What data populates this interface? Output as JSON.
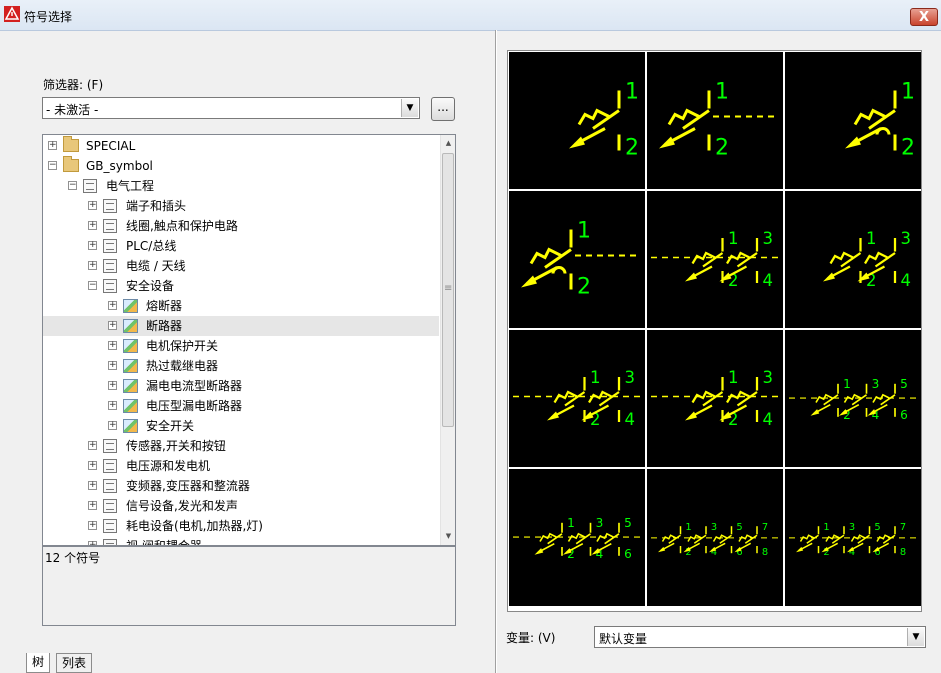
{
  "window": {
    "title": "符号选择",
    "close_label": "X"
  },
  "filter": {
    "label": "筛选器: (F)",
    "value": "- 未激活 -",
    "dots_label": "...",
    "arrow": "▼"
  },
  "tree": {
    "items": [
      {
        "label": "SPECIAL",
        "level": 0,
        "icon": "folder-icon",
        "expander": "+"
      },
      {
        "label": "GB_symbol",
        "level": 0,
        "icon": "folder-icon",
        "expander": "−"
      },
      {
        "label": "电气工程",
        "level": 1,
        "icon": "book-icon",
        "expander": "−"
      },
      {
        "label": "端子和插头",
        "level": 2,
        "icon": "book-icon",
        "expander": "+"
      },
      {
        "label": "线圈,触点和保护电路",
        "level": 2,
        "icon": "book-icon",
        "expander": "+"
      },
      {
        "label": "PLC/总线",
        "level": 2,
        "icon": "book-icon",
        "expander": "+"
      },
      {
        "label": "电缆 / 天线",
        "level": 2,
        "icon": "book-icon",
        "expander": "+"
      },
      {
        "label": "安全设备",
        "level": 2,
        "icon": "book-icon",
        "expander": "−"
      },
      {
        "label": "熔断器",
        "level": 3,
        "icon": "image-icon",
        "expander": "+"
      },
      {
        "label": "断路器",
        "level": 3,
        "icon": "image-icon",
        "expander": "+",
        "selected": true
      },
      {
        "label": "电机保护开关",
        "level": 3,
        "icon": "image-icon",
        "expander": "+"
      },
      {
        "label": "热过载继电器",
        "level": 3,
        "icon": "image-icon",
        "expander": "+"
      },
      {
        "label": "漏电电流型断路器",
        "level": 3,
        "icon": "image-icon",
        "expander": "+"
      },
      {
        "label": "电压型漏电断路器",
        "level": 3,
        "icon": "image-icon",
        "expander": "+"
      },
      {
        "label": "安全开关",
        "level": 3,
        "icon": "image-icon",
        "expander": "+"
      },
      {
        "label": "传感器,开关和按钮",
        "level": 2,
        "icon": "book-icon",
        "expander": "+"
      },
      {
        "label": "电压源和发电机",
        "level": 2,
        "icon": "book-icon",
        "expander": "+"
      },
      {
        "label": "变频器,变压器和整流器",
        "level": 2,
        "icon": "book-icon",
        "expander": "+"
      },
      {
        "label": "信号设备,发光和发声",
        "level": 2,
        "icon": "book-icon",
        "expander": "+"
      },
      {
        "label": "耗电设备(电机,加热器,灯)",
        "level": 2,
        "icon": "book-icon",
        "expander": "+"
      },
      {
        "label": "视 阀和耦合器",
        "level": 2,
        "icon": "book-icon",
        "expander": "+"
      }
    ],
    "scroll_up": "▲",
    "scroll_down": "▼",
    "grip": "≡"
  },
  "status": {
    "count_text": "12 个符号"
  },
  "tabs": [
    {
      "label": "树",
      "active": true
    },
    {
      "label": "列表",
      "active": false
    }
  ],
  "symbols": [
    {
      "poles": 1,
      "labels": [
        "1",
        "2"
      ],
      "variant": "single"
    },
    {
      "poles": 1,
      "labels": [
        "1",
        "2"
      ],
      "variant": "dashed"
    },
    {
      "poles": 1,
      "labels": [
        "1",
        "2"
      ],
      "variant": "hook"
    },
    {
      "poles": 1,
      "labels": [
        "1",
        "2"
      ],
      "variant": "hook-dashed"
    },
    {
      "poles": 2,
      "labels": [
        "1",
        "2",
        "3",
        "4"
      ],
      "variant": "dashed"
    },
    {
      "poles": 2,
      "labels": [
        "1",
        "2",
        "3",
        "4"
      ],
      "variant": "single"
    },
    {
      "poles": 2,
      "labels": [
        "1",
        "2",
        "3",
        "4"
      ],
      "variant": "small-dashed"
    },
    {
      "poles": 2,
      "labels": [
        "1",
        "2",
        "3",
        "4"
      ],
      "variant": "dashed-left"
    },
    {
      "poles": 3,
      "labels": [
        "1",
        "2",
        "3",
        "4",
        "5",
        "6"
      ],
      "variant": "dashed-left"
    },
    {
      "poles": 3,
      "labels": [
        "1",
        "2",
        "3",
        "4",
        "5",
        "6"
      ],
      "variant": "small-dashed"
    },
    {
      "poles": 4,
      "labels": [
        "1",
        "2",
        "3",
        "4",
        "5",
        "6",
        "7",
        "8"
      ],
      "variant": "dashed-left"
    },
    {
      "poles": 4,
      "labels": [
        "1",
        "2",
        "3",
        "4",
        "5",
        "6",
        "7",
        "8"
      ],
      "variant": "small-dashed"
    }
  ],
  "colors": {
    "symbol": "#ffff00",
    "pin_label": "#00ff00",
    "cell_bg": "#000000"
  },
  "variable": {
    "label": "变量: (V)",
    "value": "默认变量",
    "arrow": "▼"
  }
}
